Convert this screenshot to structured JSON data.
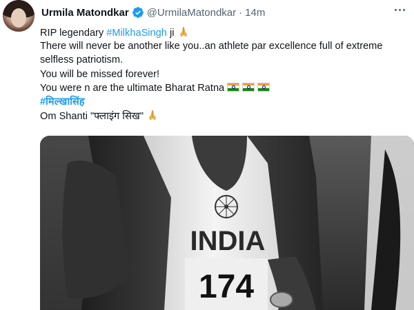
{
  "tweet": {
    "author_name": "Urmila Matondkar",
    "handle": "@UrmilaMatondkar",
    "separator": "·",
    "time": "14m",
    "lines": [
      {
        "prefix": "RIP legendary ",
        "hashtag": "#MilkhaSingh",
        "suffix": " ji"
      },
      "There will never be another like you..an athlete par excellence full of extreme",
      "selfless patriotism.",
      "You will be missed forever!",
      "You were n are the ultimate Bharat Ratna",
      "#मिल्खासिंह",
      "Om Shanti \"फ्लाइंग सिख\""
    ]
  },
  "photo": {
    "jersey_text": "INDIA",
    "bib_text": "174"
  },
  "icons": {
    "verified": "verified-badge-icon",
    "more": "more-options-icon",
    "folded_hands": "folded-hands-emoji",
    "flag": "india-flag-emoji"
  },
  "colors": {
    "link": "#1d9bf0",
    "muted": "#536471",
    "text": "#0f1419",
    "verified": "#1d9bf0"
  }
}
